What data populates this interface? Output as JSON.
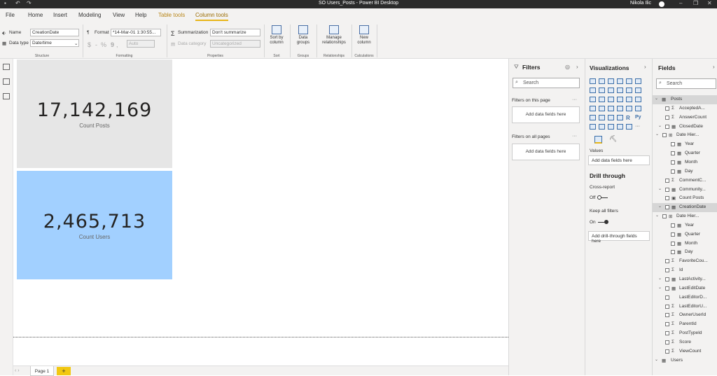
{
  "titlebar": {
    "title": "SO Users_Posts - Power BI Desktop",
    "user": "Nikola Ilic"
  },
  "menu": {
    "file": "File",
    "home": "Home",
    "insert": "Insert",
    "modeling": "Modeling",
    "view": "View",
    "help": "Help",
    "table_tools": "Table tools",
    "column_tools": "Column tools"
  },
  "ribbon": {
    "name_label": "Name",
    "name_value": "CreationDate",
    "datatype_label": "Data type",
    "datatype_value": "Date/time",
    "structure": "Structure",
    "format_label": "Format",
    "format_value": "*14-Mar-01 1:30:55...",
    "currency": "$",
    "percent": "%",
    "comma": ",",
    "decimals": "9",
    "auto": "Auto",
    "formatting": "Formatting",
    "summarization_label": "Summarization",
    "summarization_value": "Don't summarize",
    "category_label": "Data category",
    "category_value": "Uncategorized",
    "properties": "Properties",
    "sort_by_line1": "Sort by",
    "sort_by_line2": "column",
    "sort": "Sort",
    "groups_line1": "Data",
    "groups_line2": "groups",
    "groups": "Groups",
    "manage_line1": "Manage",
    "manage_line2": "relationships",
    "relationships": "Relationships",
    "newcol_line1": "New",
    "newcol_line2": "column",
    "calculations": "Calculations"
  },
  "cards": [
    {
      "value": "17,142,169",
      "label": "Count Posts"
    },
    {
      "value": "2,465,713",
      "label": "Count Users"
    }
  ],
  "pages": {
    "page1": "Page 1",
    "add": "+"
  },
  "filters": {
    "title": "Filters",
    "search": "Search",
    "on_page": "Filters on this page",
    "on_all": "Filters on all pages",
    "add_here": "Add data fields here"
  },
  "viz": {
    "title": "Visualizations",
    "values": "Values",
    "values_well": "Add data fields here",
    "drill": "Drill through",
    "cross": "Cross-report",
    "off": "Off",
    "keep": "Keep all filters",
    "on": "On",
    "drill_well": "Add drill-through fields here"
  },
  "fields": {
    "title": "Fields",
    "search": "Search",
    "items": [
      {
        "label": "Posts",
        "kind": "table"
      },
      {
        "label": "AcceptedA...",
        "kind": "sigma"
      },
      {
        "label": "AnswerCount",
        "kind": "sigma"
      },
      {
        "label": "ClosedDate",
        "kind": "date"
      },
      {
        "label": "Date Hier...",
        "kind": "hier"
      },
      {
        "label": "Year",
        "kind": "level"
      },
      {
        "label": "Quarter",
        "kind": "level"
      },
      {
        "label": "Month",
        "kind": "level"
      },
      {
        "label": "Day",
        "kind": "level"
      },
      {
        "label": "CommentC...",
        "kind": "sigma"
      },
      {
        "label": "Community...",
        "kind": "date"
      },
      {
        "label": "Count Posts",
        "kind": "measure"
      },
      {
        "label": "CreationDate",
        "kind": "date"
      },
      {
        "label": "Date Hier...",
        "kind": "hier"
      },
      {
        "label": "Year",
        "kind": "level"
      },
      {
        "label": "Quarter",
        "kind": "level"
      },
      {
        "label": "Month",
        "kind": "level"
      },
      {
        "label": "Day",
        "kind": "level"
      },
      {
        "label": "FavoriteCou...",
        "kind": "sigma"
      },
      {
        "label": "Id",
        "kind": "sigma"
      },
      {
        "label": "LastActivity...",
        "kind": "date"
      },
      {
        "label": "LastEditDate",
        "kind": "date"
      },
      {
        "label": "LastEditorD...",
        "kind": "text"
      },
      {
        "label": "LastEditorU...",
        "kind": "sigma"
      },
      {
        "label": "OwnerUserId",
        "kind": "sigma"
      },
      {
        "label": "ParentId",
        "kind": "sigma"
      },
      {
        "label": "PostTypeId",
        "kind": "sigma"
      },
      {
        "label": "Score",
        "kind": "sigma"
      },
      {
        "label": "ViewCount",
        "kind": "sigma"
      },
      {
        "label": "Users",
        "kind": "table"
      }
    ]
  }
}
